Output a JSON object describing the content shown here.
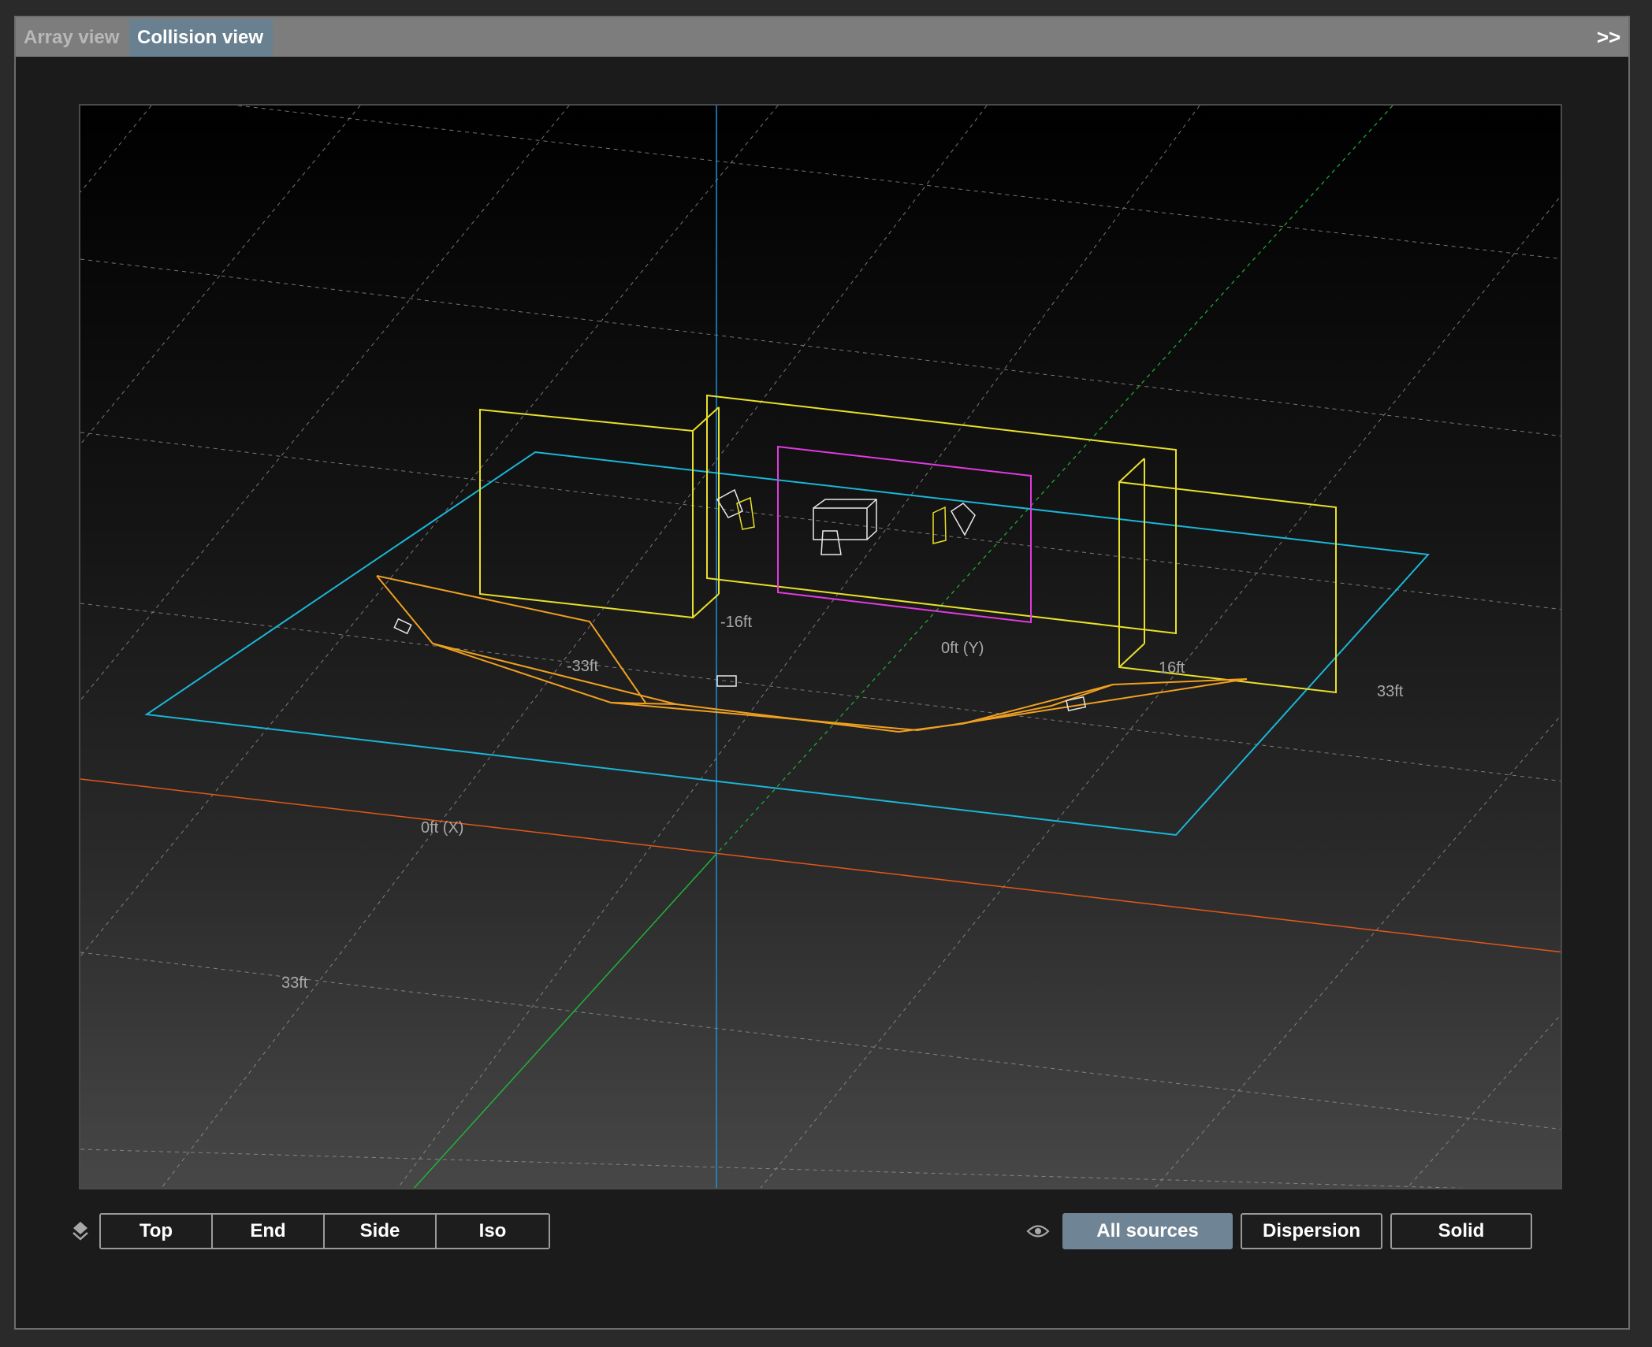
{
  "tabs": [
    {
      "label": "Array view",
      "active": false
    },
    {
      "label": "Collision view",
      "active": true
    }
  ],
  "collapse_label": ">>",
  "viewport": {
    "axis_labels": {
      "y_zero": "0ft (Y)",
      "x_zero": "0ft (X)",
      "minus16": "-16ft",
      "minus33": "-33ft",
      "plus16": "16ft",
      "plus33_right": "33ft",
      "plus33_bottom": "33ft"
    },
    "colors": {
      "x_axis": "#e0581a",
      "y_axis": "#1fb33a",
      "z_axis": "#1c8fd6",
      "floor_outline": "#1ab6d6",
      "walls": "#e8e02a",
      "screen": "#e23ae0",
      "stage": "#f0a020",
      "objects": "#ffffff"
    }
  },
  "view_buttons": [
    "Top",
    "End",
    "Side",
    "Iso"
  ],
  "display_buttons": [
    {
      "label": "All sources",
      "selected": true
    },
    {
      "label": "Dispersion",
      "selected": false
    },
    {
      "label": "Solid",
      "selected": false
    }
  ],
  "icons": {
    "layers": "layers-icon",
    "visibility": "eye-icon",
    "collapse": "double-chevron-right-icon"
  }
}
